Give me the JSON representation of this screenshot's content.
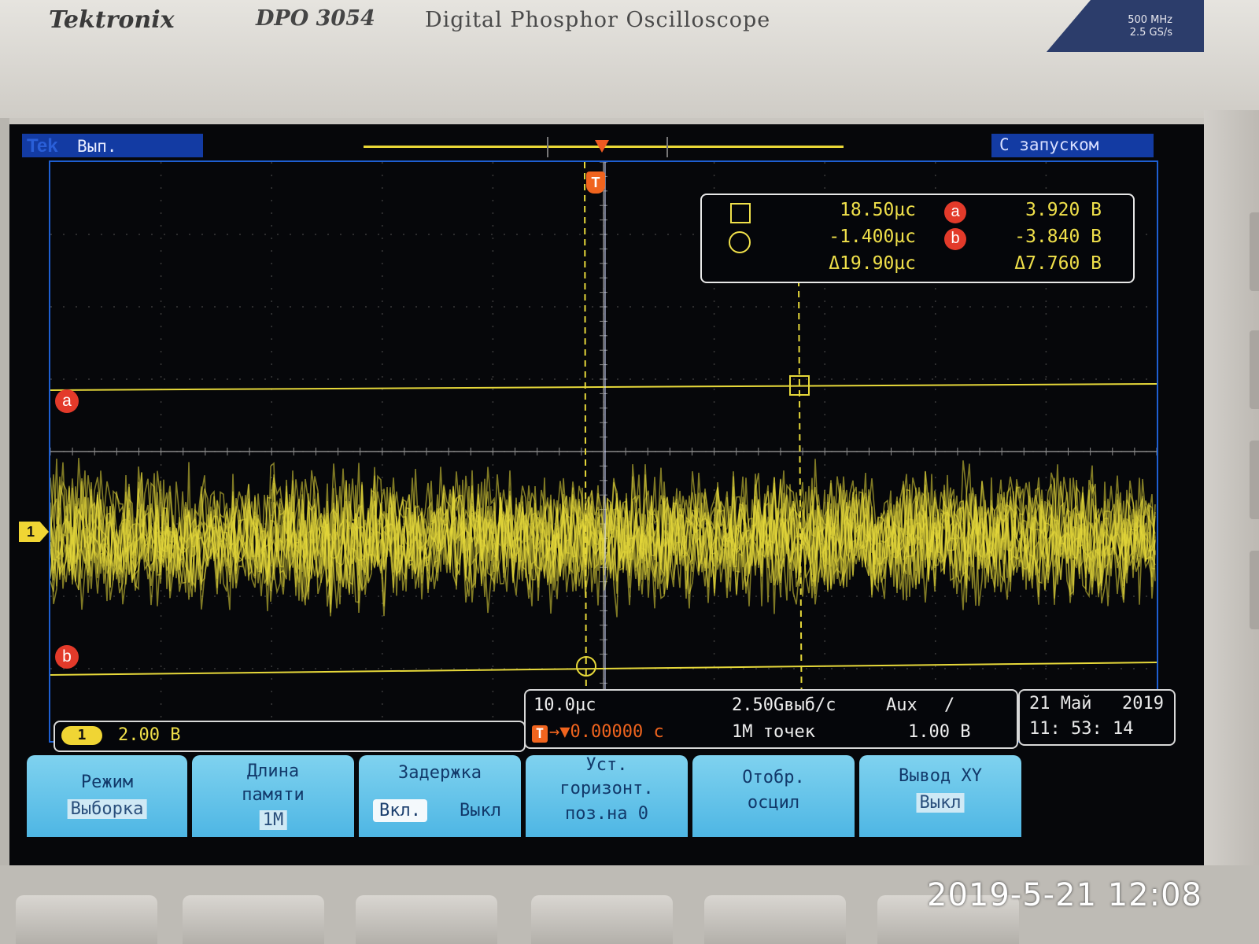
{
  "device": {
    "brand": "Tektronix",
    "model": "DPO 3054",
    "description": "Digital Phosphor Oscilloscope",
    "spec_line1": "500 MHz",
    "spec_line2": "2.5 GS/s"
  },
  "status_bar": {
    "logo": "Tek",
    "acq_state": "Вып.",
    "trigger_status": "С запуском"
  },
  "markers": {
    "trigger": "T",
    "ref_a": "a",
    "ref_b": "b",
    "channel1": "1"
  },
  "cursor_readout": {
    "t1": "18.50µс",
    "t2": "-1.400µс",
    "dt": "Δ19.90µс",
    "va_label": "a",
    "vb_label": "b",
    "va": "3.920 В",
    "vb": "-3.840 В",
    "dv": "Δ7.760 В"
  },
  "channel1": {
    "number": "1",
    "scale": "2.00 В"
  },
  "horizontal": {
    "timebase": "10.0µс",
    "trigger_icon": "T",
    "delay": "→▼0.00000 с",
    "sample_rate": "2.50Gвыб/с",
    "record_length": "1М точек",
    "trigger_source": "Aux",
    "trigger_slope": "/",
    "trigger_level": "1.00 В"
  },
  "datetime": {
    "date": "21 Май",
    "year": "2019",
    "time": "11: 53: 14"
  },
  "menu": {
    "mode": {
      "line1": "Режим",
      "value": "Выборка"
    },
    "record_length": {
      "line1": "Длина",
      "line2": "памяти",
      "value": "1М"
    },
    "delay": {
      "line1": "Задержка",
      "on": "Вкл.",
      "off": "Выкл"
    },
    "set_horiz": {
      "line1": "Уст.",
      "line2": "горизонт.",
      "line3": "поз.на 0"
    },
    "display": {
      "line1": "Отобр.",
      "line2": "осцил"
    },
    "xy": {
      "line1": "Вывод XY",
      "value": "Выкл"
    }
  },
  "photo_timestamp": "2019-5-21 12:08",
  "colors": {
    "trace": "#e6d83a",
    "grid_border": "#1e5fd2",
    "menu_bg": "#5fc0e8",
    "marker_red": "#e33a2a",
    "trigger_orange": "#f0641e"
  }
}
